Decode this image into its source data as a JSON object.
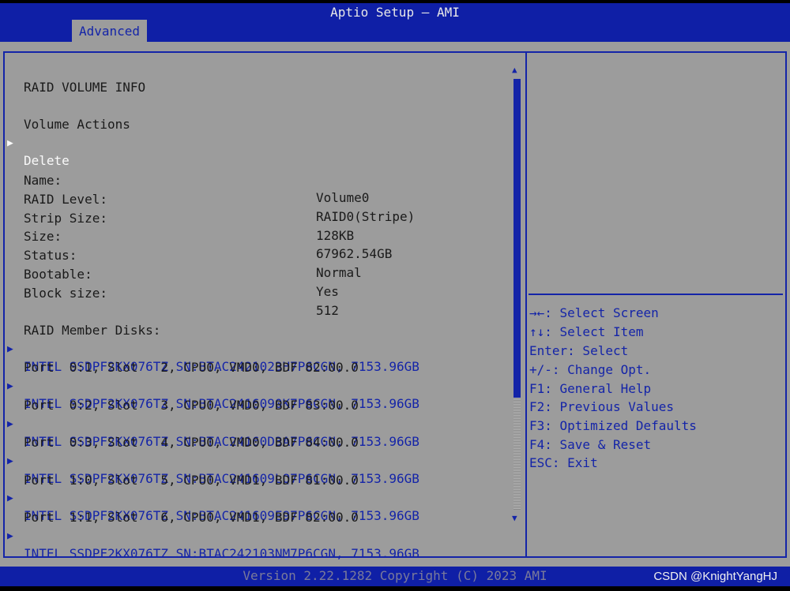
{
  "header": {
    "title": "Aptio Setup – AMI",
    "active_tab": "Advanced"
  },
  "page": {
    "heading": "RAID VOLUME INFO",
    "volume_actions_label": "Volume Actions",
    "delete_label": "Delete",
    "properties": [
      {
        "label": "Name:",
        "value": "Volume0"
      },
      {
        "label": "RAID Level:",
        "value": "RAID0(Stripe)"
      },
      {
        "label": "Strip Size:",
        "value": "128KB"
      },
      {
        "label": "Size:",
        "value": "67962.54GB"
      },
      {
        "label": "Status:",
        "value": "Normal"
      },
      {
        "label": "Bootable:",
        "value": "Yes"
      },
      {
        "label": "Block size:",
        "value": "512"
      }
    ],
    "member_disks_label": "RAID Member Disks:",
    "disks": [
      {
        "name": "INTEL SSDPF2KX076TZ SN:BTAC2421023H7P6CGN, 7153.96GB",
        "port": "Port  0:1, Slot   2, CPU0, VMD0, BDF 82:00.0"
      },
      {
        "name": "INTEL SSDPF2KX076TZ SN:BTAC2416090K7P6CGN, 7153.96GB",
        "port": "Port  0:2, Slot   3, CPU0, VMD0, BDF 83:00.0"
      },
      {
        "name": "INTEL SSDPF2KX076TZ SN:BTAC24160D3A7P6CGN, 7153.96GB",
        "port": "Port  0:3, Slot   4, CPU0, VMD0, BDF 84:00.0"
      },
      {
        "name": "INTEL SSDPF2KX076TZ SN:BTAC241609LQ7P6CGN, 7153.96GB",
        "port": "Port  1:0, Slot   5, CPU0, VMD1, BDF 81:00.0"
      },
      {
        "name": "INTEL SSDPF2KX076TZ SN:BTAC241609E97P6CGN, 7153.96GB",
        "port": "Port  1:1, Slot   6, CPU0, VMD1, BDF 82:00.0"
      },
      {
        "name": "INTEL SSDPF2KX076TZ SN:BTAC242103NM7P6CGN, 7153.96GB",
        "port": ""
      }
    ]
  },
  "help": [
    "→←: Select Screen",
    "↑↓: Select Item",
    "Enter: Select",
    "+/-: Change Opt.",
    "F1: General Help",
    "F2: Previous Values",
    "F3: Optimized Defaults",
    "F4: Save & Reset",
    "ESC: Exit"
  ],
  "scrollbar": {
    "position": 0.0,
    "visible_fraction": 0.74
  },
  "footer": {
    "version": "Version 2.22.1282 Copyright (C) 2023 AMI",
    "watermark": "CSDN @KnightYangHJ"
  },
  "icons": {
    "submenu_arrow": "right-triangle-icon",
    "scroll_up": "up-triangle-icon",
    "scroll_down": "down-triangle-icon"
  },
  "colors": {
    "frame_blue": "#1424a8",
    "bar_blue": "#0f1fa6",
    "panel_gray": "#9c9c9c",
    "selected_text": "#fafafa"
  }
}
